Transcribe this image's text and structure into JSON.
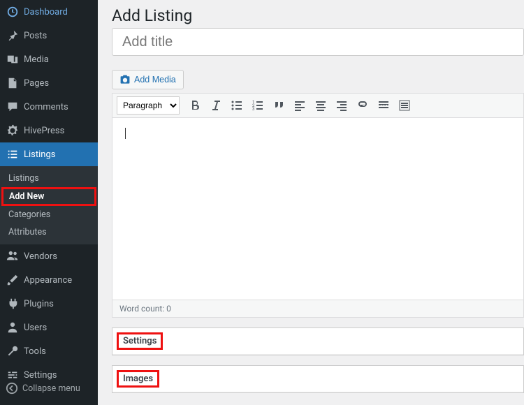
{
  "page": {
    "title": "Add Listing",
    "title_placeholder": "Add title"
  },
  "sidebar": {
    "items": [
      {
        "label": "Dashboard"
      },
      {
        "label": "Posts"
      },
      {
        "label": "Media"
      },
      {
        "label": "Pages"
      },
      {
        "label": "Comments"
      },
      {
        "label": "HivePress"
      },
      {
        "label": "Listings"
      },
      {
        "label": "Vendors"
      },
      {
        "label": "Appearance"
      },
      {
        "label": "Plugins"
      },
      {
        "label": "Users"
      },
      {
        "label": "Tools"
      },
      {
        "label": "Settings"
      }
    ],
    "submenu": {
      "items": [
        {
          "label": "Listings"
        },
        {
          "label": "Add New"
        },
        {
          "label": "Categories"
        },
        {
          "label": "Attributes"
        }
      ]
    },
    "collapse_label": "Collapse menu"
  },
  "editor": {
    "add_media_label": "Add Media",
    "format_label": "Paragraph",
    "toolbar": [
      "bold",
      "italic",
      "ul",
      "ol",
      "quote",
      "align-left",
      "align-center",
      "align-right",
      "link",
      "more",
      "fullscreen"
    ],
    "word_count_label": "Word count: 0"
  },
  "metaboxes": {
    "settings": "Settings",
    "images": "Images"
  }
}
